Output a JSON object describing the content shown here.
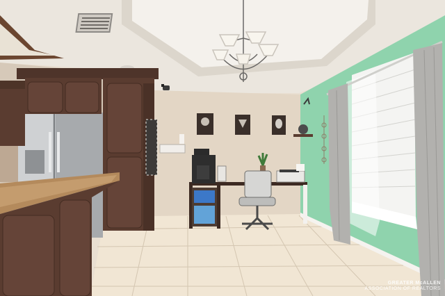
{
  "photo": {
    "scene": "kitchen and home office corner",
    "colors": {
      "ceiling": "#eeeae3",
      "wall_beige": "#e3d6c5",
      "wall_green": "#8fd3ad",
      "floor_tile": "#f1e6d4",
      "cabinet": "#5a3c30",
      "countertop": "#b48a5c",
      "fridge": "#b9bcbf",
      "curtain": "#b2b1ae",
      "blinds": "#f4f4f2"
    },
    "icons": [
      "chandelier-icon",
      "ceiling-vent-icon",
      "security-camera-icon"
    ]
  },
  "watermark": {
    "line1": "GREATER McALLEN",
    "line2": "ASSOCIATION OF REALTORS"
  }
}
